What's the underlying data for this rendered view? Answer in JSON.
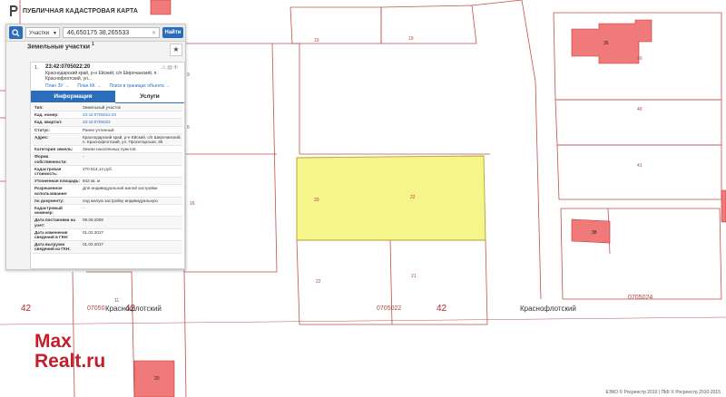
{
  "header": {
    "title": "ПУБЛИЧНАЯ КАДАСТРОВАЯ КАРТА"
  },
  "search": {
    "type_label": "Участки",
    "query": "46,650175 38,265533",
    "find_label": "Найти"
  },
  "results": {
    "title": "Земельные участки",
    "count": "1",
    "item": {
      "num": "1.",
      "cad_number": "23:42:0705022:20",
      "address": "Краснодарский край, р-н Ейский, с/п Широчанский, п. Краснофлотский, ул...",
      "links": [
        "План ЗУ →",
        "План КК →",
        "Поиск в границах объекта →"
      ]
    },
    "tabs": [
      "Информация",
      "Услуги"
    ],
    "rows": [
      {
        "k": "Тип:",
        "v": "Земельный участок",
        "link": false
      },
      {
        "k": "Кад. номер:",
        "v": "23:42:0705022:20",
        "link": true
      },
      {
        "k": "Кад. квартал:",
        "v": "23:42:0705022",
        "link": true
      },
      {
        "k": "Статус:",
        "v": "Ранее учтенный",
        "link": false
      },
      {
        "k": "Адрес:",
        "v": "Краснодарский край, р-н Ейский, с/п Широчанский, п. Краснофлотский, ул. Пролетарская, 36",
        "link": false
      },
      {
        "k": "Категория земель:",
        "v": "Земли населённых пунктов",
        "link": false
      },
      {
        "k": "Форма собственности:",
        "v": "-",
        "link": false
      },
      {
        "k": "Кадастровая стоимость:",
        "v": "270 514,14 руб.",
        "link": false
      },
      {
        "k": "Уточненная площадь:",
        "v": "942 кв. м",
        "link": false
      },
      {
        "k": "Разрешенное использование:",
        "v": "Для индивидуальной жилой застройки",
        "link": false
      },
      {
        "k": "по документу:",
        "v": "под жилую застройку индивидуальную",
        "link": false
      },
      {
        "k": "Кадастровый инженер:",
        "v": "-",
        "link": false
      },
      {
        "k": "Дата постановки на учет:",
        "v": "09.06.2009",
        "link": false
      },
      {
        "k": "Дата изменения сведений в ГКН:",
        "v": "01.02.2017",
        "link": false
      },
      {
        "k": "Дата выгрузки сведений из ГКН:",
        "v": "01.02.2017",
        "link": false
      }
    ]
  },
  "map": {
    "parcel_labels": [
      "19",
      "19",
      "9",
      "6",
      "16",
      "20",
      "22",
      "22",
      "21",
      "11",
      "40",
      "40",
      "41"
    ],
    "quarter_labels": [
      "0705022",
      "0705024",
      "07050"
    ],
    "region_labels": [
      "42",
      "42",
      "42"
    ],
    "place_names": [
      "Краснофлотский",
      "Краснофлотский"
    ],
    "building_labels": [
      "36",
      "38",
      "20"
    ]
  },
  "watermark": {
    "line1": "Max",
    "line2": "Realt.ru"
  },
  "copyright": "ЕЭКО © Росреестр 2010 | ПКК © Росреестр 2010-2015",
  "colors": {
    "accent": "#2a6ebb",
    "parcel_line": "#c0504d",
    "selected_fill": "#f5f58a",
    "building_fill": "#f07a7a"
  }
}
